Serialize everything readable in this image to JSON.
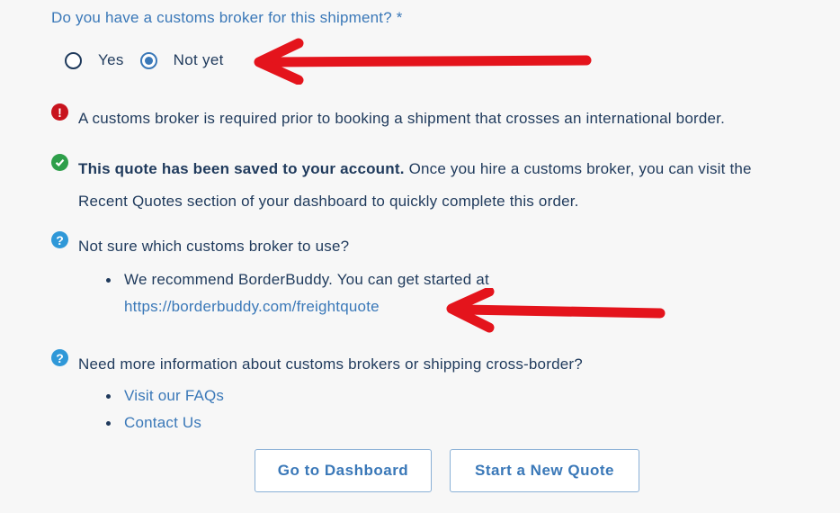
{
  "question": {
    "label": "Do you have a customs broker for this shipment? *"
  },
  "radio": {
    "options": [
      {
        "label": "Yes",
        "selected": false
      },
      {
        "label": "Not yet",
        "selected": true
      }
    ]
  },
  "error": {
    "text": "A customs broker is required prior to booking a shipment that crosses an international border."
  },
  "saved": {
    "bold": "This quote has been saved to your account.",
    "text_line1": " Once you hire a customs broker, you can visit the",
    "text_line2": "Recent Quotes section of your dashboard to quickly complete this order."
  },
  "broker_help": {
    "title": "Not sure which customs broker to use?",
    "bullet_text": "We recommend BorderBuddy. You can get started at",
    "link": "https://borderbuddy.com/freightquote"
  },
  "info_help": {
    "title": "Need more information about customs brokers or shipping cross-border?",
    "links": [
      "Visit our FAQs",
      "Contact Us"
    ]
  },
  "buttons": {
    "dashboard": "Go to Dashboard",
    "new_quote": "Start a New Quote"
  },
  "colors": {
    "accent": "#3a78b8",
    "text": "#1f3a5c",
    "error": "#c8141e",
    "success": "#2e9f4a",
    "help": "#2f98d8",
    "annotation": "#e4141c"
  }
}
